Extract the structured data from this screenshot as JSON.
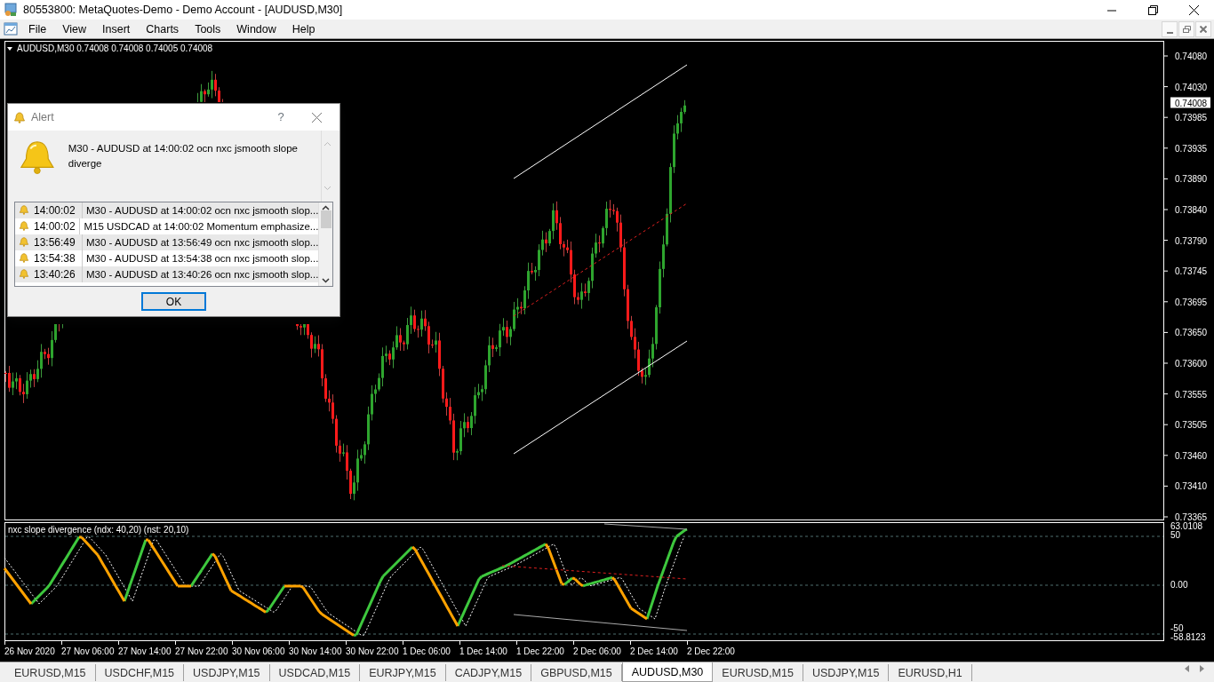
{
  "window": {
    "title": "80553800: MetaQuotes-Demo - Demo Account - [AUDUSD,M30]"
  },
  "menu": [
    "File",
    "View",
    "Insert",
    "Charts",
    "Tools",
    "Window",
    "Help"
  ],
  "chart": {
    "header": "AUDUSD,M30  0.74008 0.74008 0.74005 0.74008",
    "price_labels": [
      "0.74080",
      "0.74030",
      "0.73985",
      "0.73935",
      "0.73890",
      "0.73840",
      "0.73790",
      "0.73745",
      "0.73695",
      "0.73650",
      "0.73600",
      "0.73555",
      "0.73505",
      "0.73460",
      "0.73410",
      "0.73365"
    ],
    "current_price": "0.74008",
    "indicator": {
      "title": "nxc slope divergence (ndx: 40,20) (nst: 20,10)",
      "labels": [
        "63.0108",
        "50",
        "0.00",
        "-50",
        "-58.8123"
      ]
    },
    "time_labels": [
      "26 Nov 2020",
      "27 Nov 06:00",
      "27 Nov 14:00",
      "27 Nov 22:00",
      "30 Nov 06:00",
      "30 Nov 14:00",
      "30 Nov 22:00",
      "1 Dec 06:00",
      "1 Dec 14:00",
      "1 Dec 22:00",
      "2 Dec 06:00",
      "2 Dec 14:00",
      "2 Dec 22:00"
    ]
  },
  "alert": {
    "title": "Alert",
    "help": "?",
    "message": "M30 - AUDUSD at 14:00:02 ocn nxc jsmooth slope diverge",
    "button": "OK",
    "rows": [
      {
        "time": "14:00:02",
        "text": "M30 - AUDUSD at 14:00:02 ocn nxc jsmooth slop..."
      },
      {
        "time": "14:00:02",
        "text": "M15 USDCAD at 14:00:02 Momentum emphasize..."
      },
      {
        "time": "13:56:49",
        "text": "M30 - AUDUSD at 13:56:49 ocn nxc jsmooth slop..."
      },
      {
        "time": "13:54:38",
        "text": "M30 - AUDUSD at 13:54:38 ocn nxc jsmooth slop..."
      },
      {
        "time": "13:40:26",
        "text": "M30 - AUDUSD at 13:40:26 ocn nxc jsmooth slop..."
      }
    ]
  },
  "tabs": [
    {
      "label": "EURUSD,M15",
      "selected": false
    },
    {
      "label": "USDCHF,M15",
      "selected": false
    },
    {
      "label": "USDJPY,M15",
      "selected": false
    },
    {
      "label": "USDCAD,M15",
      "selected": false
    },
    {
      "label": "EURJPY,M15",
      "selected": false
    },
    {
      "label": "CADJPY,M15",
      "selected": false
    },
    {
      "label": "GBPUSD,M15",
      "selected": false
    },
    {
      "label": "AUDUSD,M30",
      "selected": true
    },
    {
      "label": "EURUSD,M15",
      "selected": false
    },
    {
      "label": "USDJPY,M15",
      "selected": false
    },
    {
      "label": "EURUSD,H1",
      "selected": false
    }
  ]
}
